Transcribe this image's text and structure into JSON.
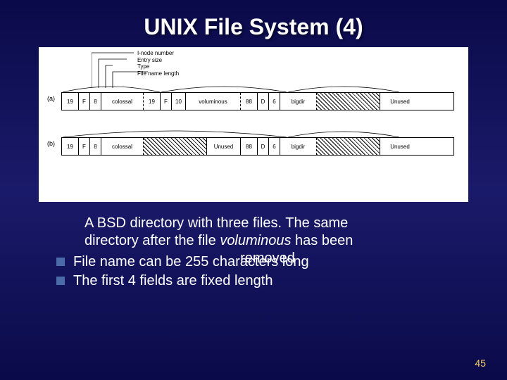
{
  "title": "UNIX File System (4)",
  "legend": {
    "l1": "I-node number",
    "l2": "Entry size",
    "l3": "Type",
    "l4": "File name length"
  },
  "rowA": {
    "label": "(a)",
    "e1": {
      "inode": "19",
      "f": "F",
      "size": "8",
      "name": "colossal"
    },
    "e2": {
      "inode": "19",
      "f": "F",
      "size": "10",
      "name": "voluminous"
    },
    "e3": {
      "inode": "88",
      "f": "D",
      "size": "6",
      "name": "bigdir"
    },
    "unused": "Unused"
  },
  "rowB": {
    "label": "(b)",
    "e1": {
      "inode": "19",
      "f": "F",
      "size": "8",
      "name": "colossal"
    },
    "unused1": "Unused",
    "e3": {
      "inode": "88",
      "f": "D",
      "size": "6",
      "name": "bigdir"
    },
    "unused2": "Unused"
  },
  "caption": {
    "line1": "A BSD directory with three files. The same",
    "line2_a": "directory after the file ",
    "line2_b": "voluminous",
    "line2_c": " has been",
    "line3": "removed"
  },
  "bullets": {
    "b1": "File name can be 255 characters long",
    "b2": "The first 4 fields are fixed length"
  },
  "pagenum": "45"
}
